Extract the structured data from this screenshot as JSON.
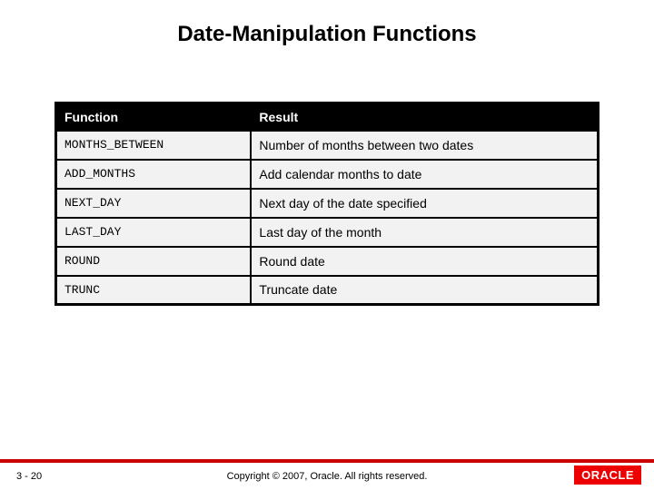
{
  "title": "Date-Manipulation Functions",
  "table": {
    "headers": {
      "function": "Function",
      "result": "Result"
    },
    "rows": [
      {
        "function": "MONTHS_BETWEEN",
        "result": "Number of months between two dates"
      },
      {
        "function": "ADD_MONTHS",
        "result": "Add calendar months to date"
      },
      {
        "function": "NEXT_DAY",
        "result": "Next day of the date specified"
      },
      {
        "function": "LAST_DAY",
        "result": "Last day of the month"
      },
      {
        "function": "ROUND",
        "result": "Round date"
      },
      {
        "function": "TRUNC",
        "result": "Truncate date"
      }
    ]
  },
  "footer": {
    "page": "3 - 20",
    "copyright": "Copyright © 2007, Oracle. All rights reserved.",
    "logo": "ORACLE"
  }
}
